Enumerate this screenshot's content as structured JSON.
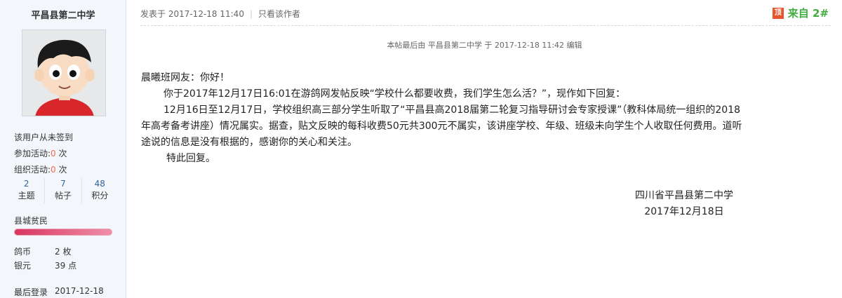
{
  "author": {
    "name": "平昌县第二中学",
    "sign_status": "该用户从未签到",
    "activity_join_label": "参加活动:",
    "activity_join_count": "0",
    "activity_join_unit": "次",
    "activity_org_label": "组织活动:",
    "activity_org_count": "0",
    "activity_org_unit": "次",
    "counts": [
      {
        "num": "2",
        "label": "主题"
      },
      {
        "num": "7",
        "label": "帖子"
      },
      {
        "num": "48",
        "label": "积分"
      }
    ],
    "rank": "县城贫民",
    "coins_label": "鸽币",
    "coins_value": "2 枚",
    "silver_label": "银元",
    "silver_value": "39 点",
    "last_login_label": "最后登录",
    "last_login_value": "2017-12-18"
  },
  "post": {
    "posted_at": "发表于 2017-12-18 11:40",
    "only_author": "只看该作者",
    "top_badge": "顶",
    "floor": "来自 2#",
    "edit_note": "本帖最后由 平昌县第二中学 于 2017-12-18 11:42 编辑",
    "lines": [
      "晨曦班网友：你好！",
      "你于2017年12月17日16:01在游鸽网发帖反映“学校什么都要收费，我们学生怎么活？”，现作如下回复：",
      "12月16日至12月17日，学校组织高三部分学生听取了“平昌县高2018届第二轮复习指导研讨会专家授课”（教科体局统一组织的2018",
      "年高考备考讲座）情况属实。据查，贴文反映的每科收费50元共300元不属实，该讲座学校、年级、班级未向学生个人收取任何费用。道听",
      "途说的信息是没有根据的，感谢你的关心和关注。",
      "特此回复。"
    ],
    "signature_org": "四川省平昌县第二中学",
    "signature_date": "2017年12月18日"
  },
  "colors": {
    "sidebar_bg": "#f3f7fb",
    "accent_red": "#f26c4f",
    "floor_green": "#3fae3f",
    "link_blue": "#336699"
  }
}
